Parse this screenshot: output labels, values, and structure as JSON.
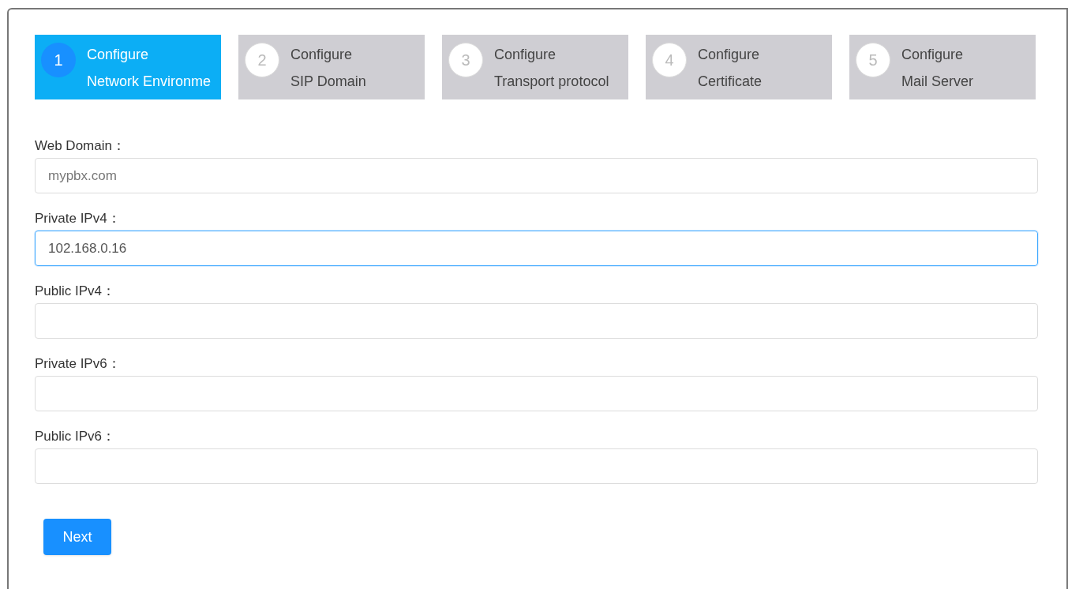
{
  "steps": [
    {
      "number": "1",
      "title": "Configure",
      "subtitle": "Network Environme",
      "selected": true
    },
    {
      "number": "2",
      "title": "Configure",
      "subtitle": "SIP Domain",
      "selected": false
    },
    {
      "number": "3",
      "title": "Configure",
      "subtitle": "Transport protocol",
      "selected": false
    },
    {
      "number": "4",
      "title": "Configure",
      "subtitle": "Certificate",
      "selected": false
    },
    {
      "number": "5",
      "title": "Configure",
      "subtitle": "Mail Server",
      "selected": false
    }
  ],
  "fields": [
    {
      "label": "Web Domain：",
      "placeholder": "mypbx.com",
      "focused": false
    },
    {
      "label": "Private IPv4：",
      "value": "102.168.0.16",
      "focused": true
    },
    {
      "label": "Public IPv4：",
      "focused": false
    },
    {
      "label": "Private IPv6：",
      "focused": false
    },
    {
      "label": "Public IPv6：",
      "focused": false
    }
  ],
  "next_button": "Next"
}
